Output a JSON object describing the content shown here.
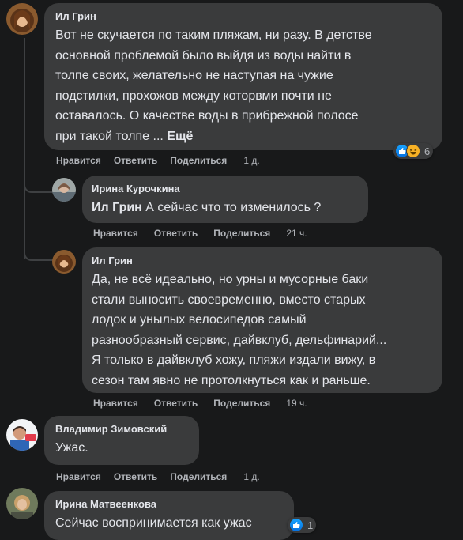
{
  "actions": {
    "like": "Нравится",
    "reply": "Ответить",
    "share": "Поделиться"
  },
  "comments": [
    {
      "author": "Ил Грин",
      "lines": [
        "Вот не скучается по таким пляжам, ни разу. В детстве",
        "основной проблемой было выйдя из воды найти в",
        "толпе своих, желательно не наступая на чужие",
        "подстилки, прохожов между которвми почти не",
        "оставалось. О качестве воды в прибрежной полосе",
        "при такой толпе ..."
      ],
      "more": "Ещё",
      "time": "1 д.",
      "reactions": {
        "icons": [
          "like-icon",
          "haha-icon"
        ],
        "count": "6"
      }
    },
    {
      "author": "Ирина Курочкина",
      "mention": "Ил Грин",
      "text": "А сейчас что то изменилось ?",
      "time": "21 ч."
    },
    {
      "author": "Ил Грин",
      "lines": [
        "Да, не всё идеально, но урны и мусорные баки",
        "стали выносить своевременно, вместо старых",
        "лодок и унылых велосипедов самый",
        "разнообразный сервис, дайвклуб, дельфинарий...",
        "Я только в дайвклуб хожу, пляжи издали вижу, в",
        "сезон там явно не протолкнуться как и раньше."
      ],
      "time": "19 ч."
    },
    {
      "author": "Владимир Зимовский",
      "text": "Ужас.",
      "time": "1 д."
    },
    {
      "author": "Ирина Матвеенкова",
      "text": "Сейчас воспринимается как ужас",
      "reactions": {
        "icons": [
          "like-icon"
        ],
        "count": "1"
      }
    }
  ],
  "colors": {
    "background": "#18191a",
    "bubble": "#3a3b3c",
    "text": "#e4e6eb",
    "secondary": "#b0b3b8",
    "like": "#1877f2"
  }
}
